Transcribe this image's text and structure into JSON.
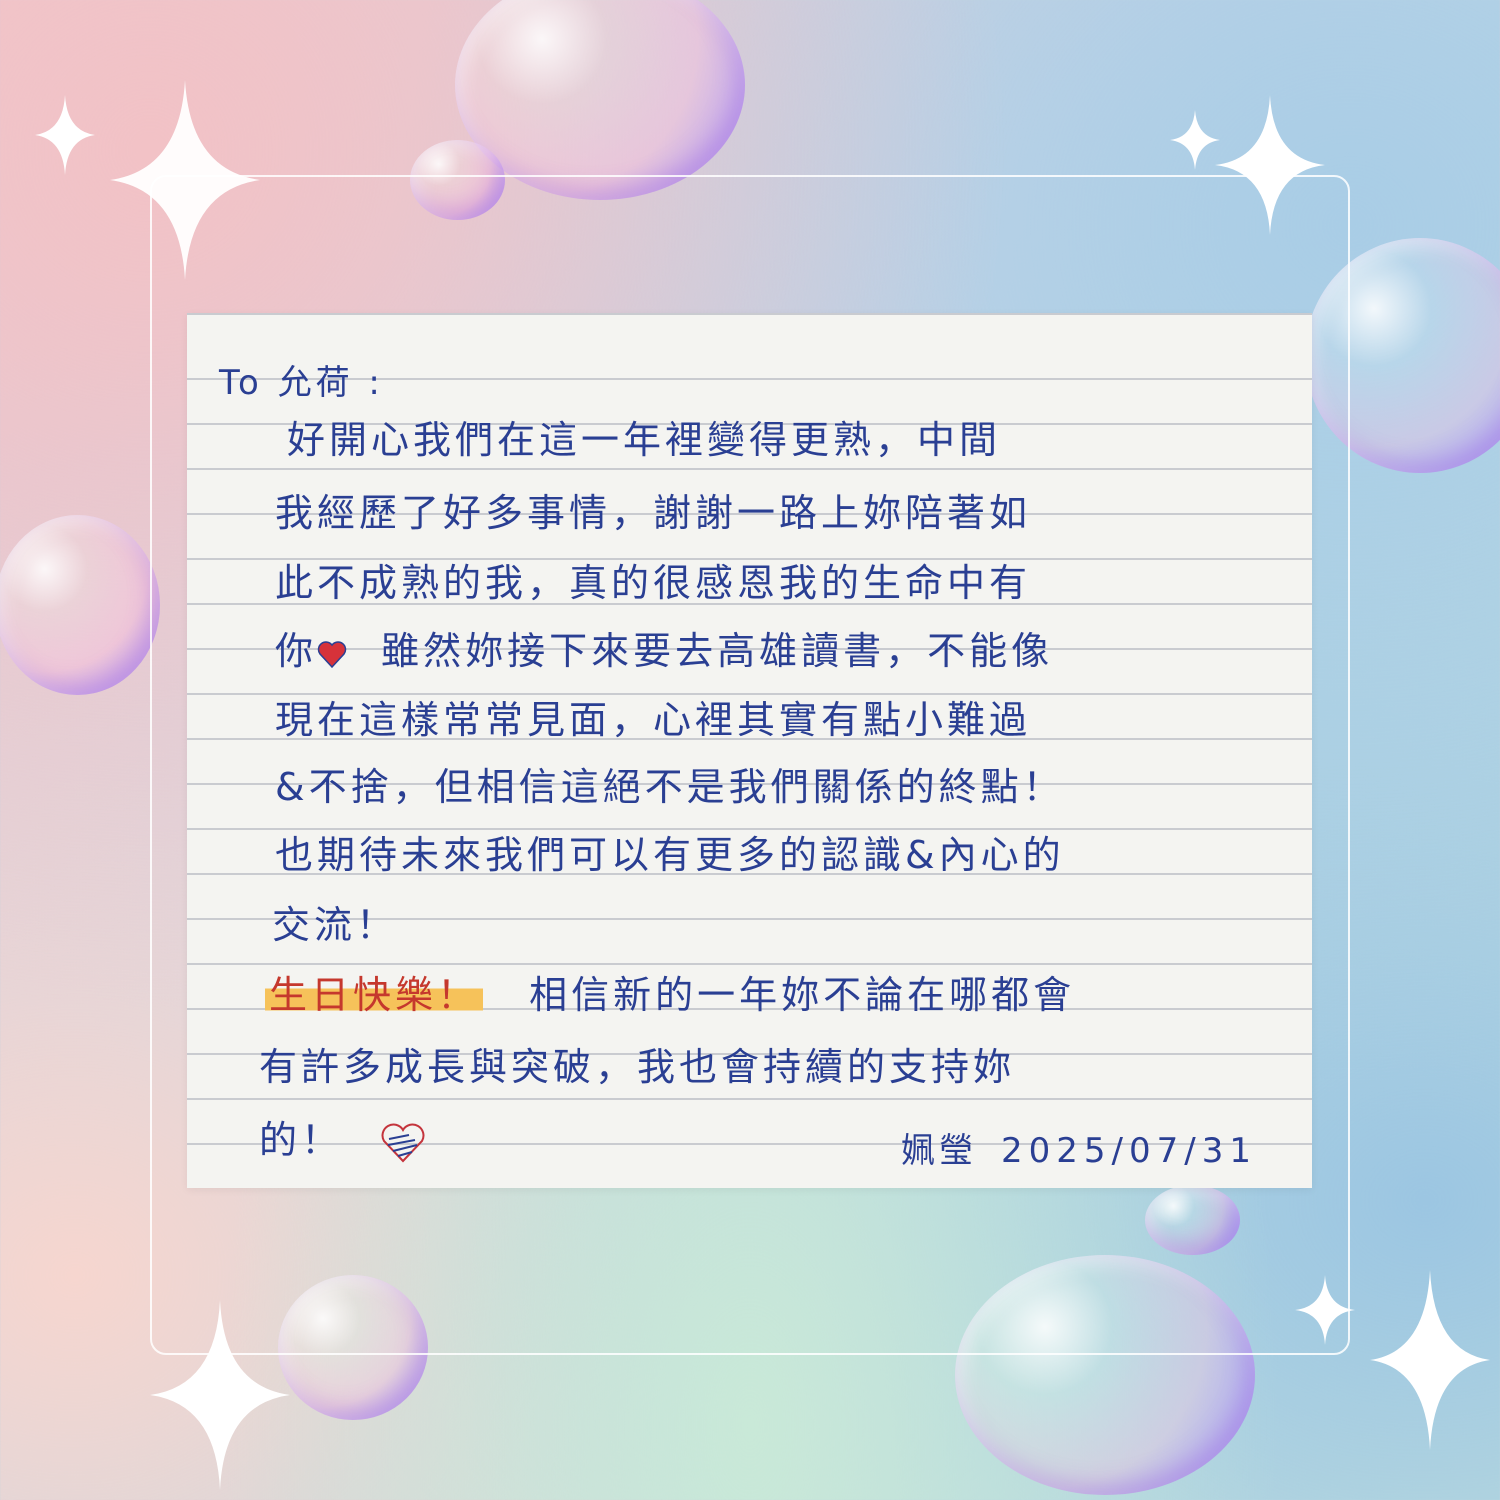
{
  "letter": {
    "greeting": "To 允荷 :",
    "lines": [
      "好開心我們在這一年裡變得更熟，中間",
      "我經歷了好多事情，謝謝一路上妳陪著如",
      "此不成熟的我，真的很感恩我的生命中有",
      "你",
      "雖然妳接下來要去高雄讀書，不能像",
      "現在這樣常常見面，心裡其實有點小難過",
      "&不捨，但相信這絕不是我們關係的終點！",
      "也期待未來我們可以有更多的認識&內心的",
      "交流！",
      "生日快樂！",
      "相信新的一年妳不論在哪都會",
      "有許多成長與突破，我也會持續的支持妳",
      "的！"
    ],
    "signature_name": "姵瑩",
    "signature_date": "2025/07/31"
  },
  "colors": {
    "ink": "#2a3f93",
    "highlight": "#f6c25a",
    "highlight_text": "#c5382d",
    "heart": "#d6323a"
  },
  "icons": [
    "red-heart-icon",
    "striped-heart-icon",
    "sparkle-icon",
    "bubble-icon"
  ]
}
